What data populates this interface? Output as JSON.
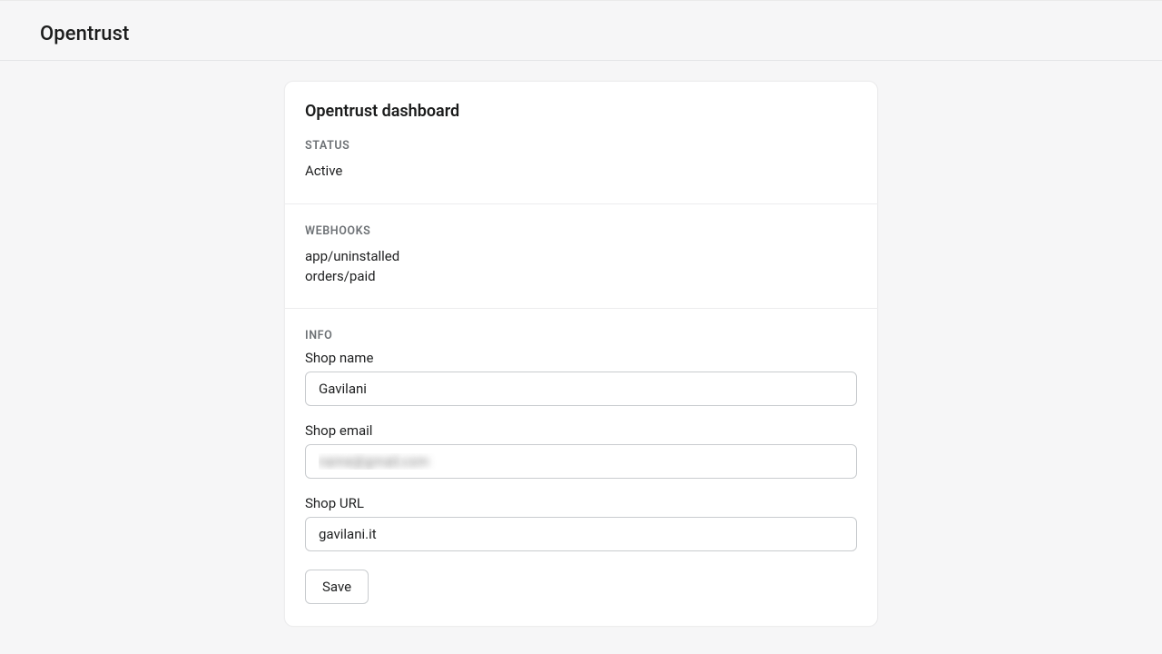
{
  "header": {
    "title": "Opentrust"
  },
  "card": {
    "title": "Opentrust dashboard",
    "status": {
      "label": "STATUS",
      "value": "Active"
    },
    "webhooks": {
      "label": "WEBHOOKS",
      "items": [
        "app/uninstalled",
        "orders/paid"
      ]
    },
    "info": {
      "label": "INFO",
      "shop_name": {
        "label": "Shop name",
        "value": "Gavilani"
      },
      "shop_email": {
        "label": "Shop email",
        "value": "name@gmail.com"
      },
      "shop_url": {
        "label": "Shop URL",
        "value": "gavilani.it"
      },
      "save_label": "Save"
    }
  }
}
